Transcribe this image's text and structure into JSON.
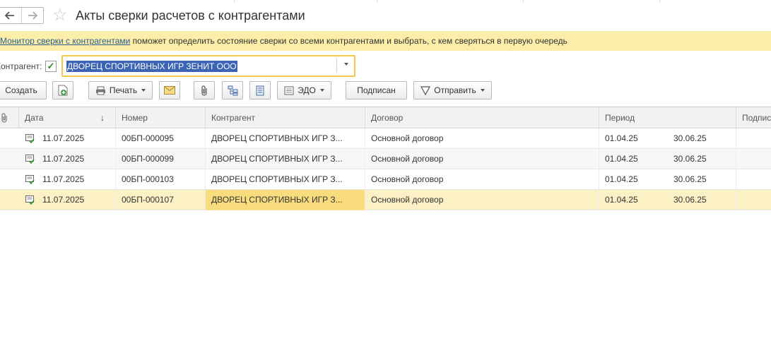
{
  "window": {
    "title": "Акты сверки расчетов с контрагентами"
  },
  "banner": {
    "link": "Монитор сверки с контрагентами",
    "text": " поможет определить состояние сверки со всеми контрагентами и выбрать, с кем сверяться в первую очередь"
  },
  "filter": {
    "label": "Контрагент:",
    "checked": true,
    "value": "ДВОРЕЦ СПОРТИВНЫХ ИГР ЗЕНИТ ООО"
  },
  "toolbar": {
    "create": "Создать",
    "print": "Печать",
    "edo": "ЭДО",
    "signed": "Подписан",
    "send": "Отправить"
  },
  "table": {
    "headers": {
      "date": "Дата",
      "sort": "↓",
      "number": "Номер",
      "counterparty": "Контрагент",
      "contract": "Договор",
      "period": "Период",
      "signature": "Подпис"
    },
    "rows": [
      {
        "date": "11.07.2025",
        "number": "00БП-000095",
        "counterparty": "ДВОРЕЦ СПОРТИВНЫХ ИГР З...",
        "contract": "Основной договор",
        "period_start": "01.04.25",
        "period_end": "30.06.25"
      },
      {
        "date": "11.07.2025",
        "number": "00БП-000099",
        "counterparty": "ДВОРЕЦ СПОРТИВНЫХ ИГР З...",
        "contract": "Основной договор",
        "period_start": "01.04.25",
        "period_end": "30.06.25"
      },
      {
        "date": "11.07.2025",
        "number": "00БП-000103",
        "counterparty": "ДВОРЕЦ СПОРТИВНЫХ ИГР З...",
        "contract": "Основной договор",
        "period_start": "01.04.25",
        "period_end": "30.06.25"
      },
      {
        "date": "11.07.2025",
        "number": "00БП-000107",
        "counterparty": "ДВОРЕЦ СПОРТИВНЫХ ИГР З...",
        "contract": "Основной договор",
        "period_start": "01.04.25",
        "period_end": "30.06.25"
      }
    ]
  },
  "colors": {
    "banner_bg": "#fbeea8",
    "selected_row": "#fcf1c5",
    "active_cell": "#f8dc7d",
    "combo_border": "#f0c94a",
    "selection_bg": "#3c64b4",
    "link": "#2a5d8f"
  },
  "icons": {
    "back": "arrow-left-icon",
    "forward": "arrow-right-icon",
    "favorite": "star-icon",
    "attachment": "paperclip-icon",
    "row_doc": "document-check-icon"
  }
}
